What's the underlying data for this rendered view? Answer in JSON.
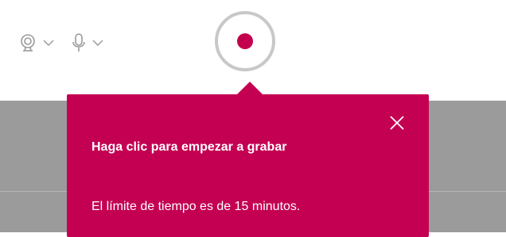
{
  "toolbar": {
    "camera": {
      "icon": "webcam-icon",
      "chevron_icon": "chevron-down-icon"
    },
    "microphone": {
      "icon": "microphone-icon",
      "chevron_icon": "chevron-down-icon"
    },
    "record": {
      "icon": "record-icon",
      "color": "#c4004e"
    }
  },
  "tooltip": {
    "title": "Haga clic para empezar a grabar",
    "body": "El límite de tiempo es de 15 minutos.",
    "close_icon": "close-icon",
    "background": "#c40052"
  }
}
